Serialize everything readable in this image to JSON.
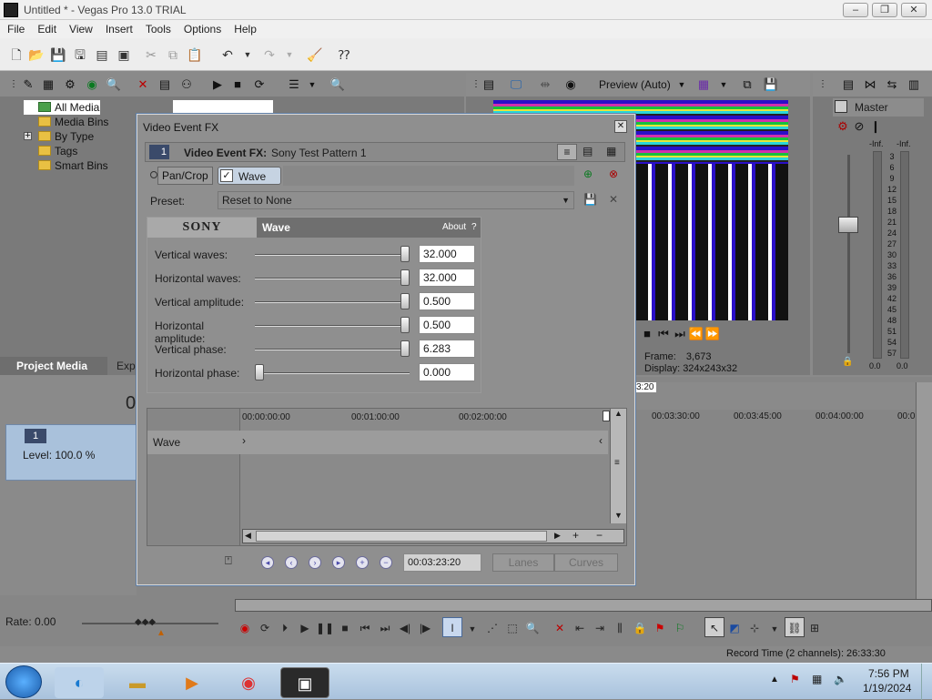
{
  "app": {
    "title": "Untitled * - Vegas Pro 13.0 TRIAL",
    "window_buttons": [
      "–",
      "❐",
      "✕"
    ]
  },
  "menu": [
    "File",
    "Edit",
    "View",
    "Insert",
    "Tools",
    "Options",
    "Help"
  ],
  "media": {
    "tree": [
      {
        "label": "All Media",
        "selected": true
      },
      {
        "label": "Media Bins"
      },
      {
        "label": "By Type",
        "expander": "+"
      },
      {
        "label": "Tags"
      },
      {
        "label": "Smart Bins"
      }
    ],
    "tabs": [
      "Project Media",
      "Expl"
    ]
  },
  "preview": {
    "quality": "Preview (Auto)",
    "frame_label": "Frame:",
    "frame_value": "3,673",
    "display_label": "Display:",
    "display_value": "324x243x32"
  },
  "mixer": {
    "title": "Master",
    "left_peak": "-Inf.",
    "right_peak": "-Inf.",
    "scale": [
      "3",
      "6",
      "9",
      "12",
      "15",
      "18",
      "21",
      "24",
      "27",
      "30",
      "33",
      "36",
      "39",
      "42",
      "45",
      "48",
      "51",
      "54",
      "57"
    ],
    "left_value": "0.0",
    "right_value": "0.0"
  },
  "dialog": {
    "title": "Video Event FX",
    "close": "✕",
    "fx_badge": "1",
    "fx_label": "Video Event FX:",
    "fx_name": "Sony Test Pattern 1",
    "chain": [
      "Pan/Crop",
      "Wave"
    ],
    "preset_label": "Preset:",
    "preset_value": "Reset to None",
    "brand": "SONY",
    "plugin_name": "Wave",
    "about": "About",
    "help": "?",
    "params": [
      {
        "label": "Vertical waves:",
        "value": "32.000",
        "fraction": 1.0
      },
      {
        "label": "Horizontal waves:",
        "value": "32.000",
        "fraction": 1.0
      },
      {
        "label": "Vertical amplitude:",
        "value": "0.500",
        "fraction": 1.0
      },
      {
        "label": "Horizontal amplitude:",
        "value": "0.500",
        "fraction": 1.0
      },
      {
        "label": "Vertical phase:",
        "value": "6.283",
        "fraction": 1.0
      },
      {
        "label": "Horizontal phase:",
        "value": "0.000",
        "fraction": 0.0
      }
    ],
    "timeline_ticks": [
      "00:00:00:00",
      "00:01:00:00",
      "00:02:00:00"
    ],
    "track_label": "Wave",
    "timecode": "00:03:23:20",
    "lanes": "Lanes",
    "curves": "Curves"
  },
  "timeline": {
    "ruler_ticks": [
      "00:03:30:00",
      "00:03:45:00",
      "00:04:00:00",
      "00:0"
    ],
    "marker_text": "3:20",
    "track_number": "1",
    "level": "Level: 100.0 %",
    "time_partial": "0",
    "rate": "Rate: 0.00",
    "record_time": "Record Time (2 channels): 26:33:30"
  },
  "tray": {
    "time": "7:56 PM",
    "date": "1/19/2024"
  }
}
